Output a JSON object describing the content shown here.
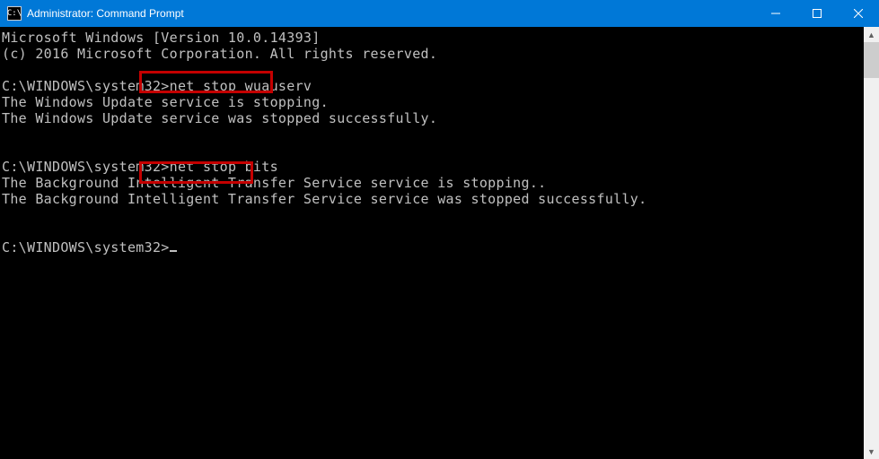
{
  "window": {
    "title": "Administrator: Command Prompt",
    "icon_text": "C:\\"
  },
  "console": {
    "header1": "Microsoft Windows [Version 10.0.14393]",
    "header2": "(c) 2016 Microsoft Corporation. All rights reserved.",
    "prompt": "C:\\WINDOWS\\system32>",
    "cmd1": "net stop wuauserv",
    "out1a": "The Windows Update service is stopping.",
    "out1b": "The Windows Update service was stopped successfully.",
    "cmd2": "net stop bits",
    "out2a": "The Background Intelligent Transfer Service service is stopping..",
    "out2b": "The Background Intelligent Transfer Service service was stopped successfully."
  }
}
